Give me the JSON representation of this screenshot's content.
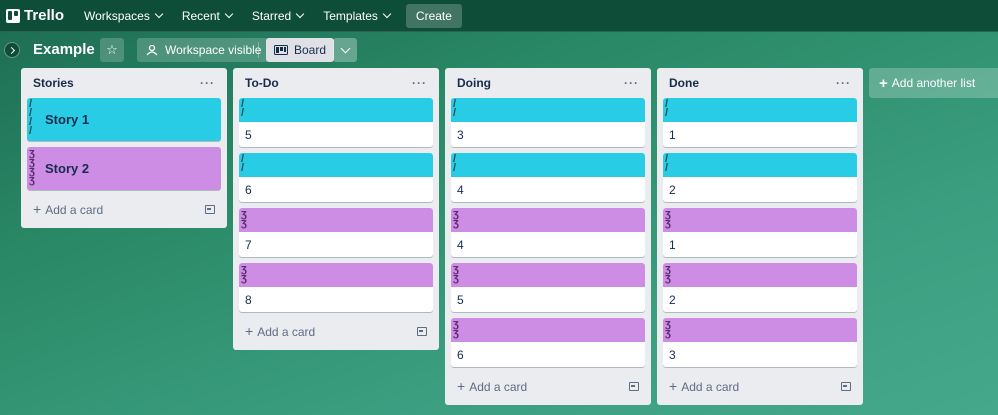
{
  "topnav": {
    "logo": "Trello",
    "items": [
      "Workspaces",
      "Recent",
      "Starred",
      "Templates"
    ],
    "create": "Create"
  },
  "board": {
    "title": "Example",
    "visibility": "Workspace visible",
    "view": "Board"
  },
  "lists": [
    {
      "title": "Stories",
      "story_cards": [
        {
          "label": "Story 1",
          "color": "#29cce5"
        },
        {
          "label": "Story 2",
          "color": "#cd8de5"
        }
      ],
      "add_card": "Add a card"
    },
    {
      "title": "To-Do",
      "cards": [
        {
          "text": "5",
          "cover": "cyan"
        },
        {
          "text": "6",
          "cover": "cyan"
        },
        {
          "text": "7",
          "cover": "purple"
        },
        {
          "text": "8",
          "cover": "purple"
        }
      ],
      "add_card": "Add a card"
    },
    {
      "title": "Doing",
      "cards": [
        {
          "text": "3",
          "cover": "cyan"
        },
        {
          "text": "4",
          "cover": "cyan"
        },
        {
          "text": "4",
          "cover": "purple"
        },
        {
          "text": "5",
          "cover": "purple"
        },
        {
          "text": "6",
          "cover": "purple"
        }
      ],
      "add_card": "Add a card"
    },
    {
      "title": "Done",
      "cards": [
        {
          "text": "1",
          "cover": "cyan"
        },
        {
          "text": "2",
          "cover": "cyan"
        },
        {
          "text": "1",
          "cover": "purple"
        },
        {
          "text": "2",
          "cover": "purple"
        },
        {
          "text": "3",
          "cover": "purple"
        }
      ],
      "add_card": "Add a card"
    }
  ],
  "add_list": "Add another list",
  "colors": {
    "cyan": "#29cce5",
    "purple": "#cd8de5",
    "nav": "#0e4d38"
  }
}
